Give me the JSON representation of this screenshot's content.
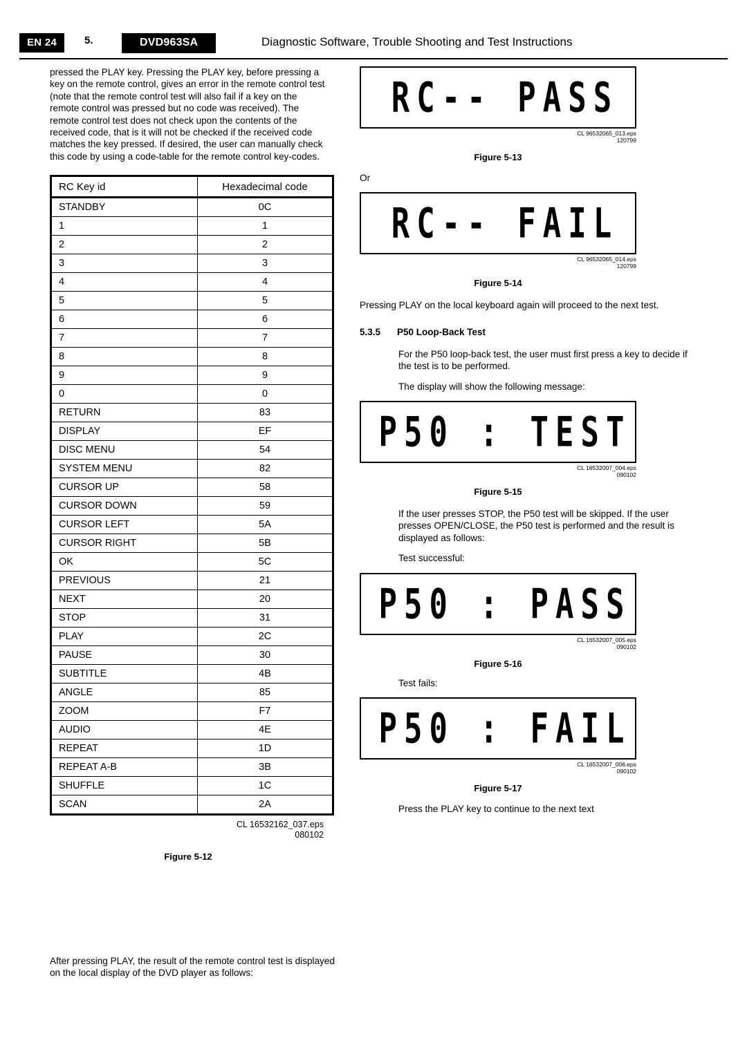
{
  "header": {
    "page_label": "EN 24",
    "section_number": "5.",
    "model": "DVD963SA",
    "title": "Diagnostic Software, Trouble Shooting and Test Instructions"
  },
  "left": {
    "intro_paragraph": "pressed the PLAY key. Pressing the PLAY key, before pressing a key on the remote control, gives an error in the remote control test (note that the remote control test will also fail if a key on the remote control was pressed but no code was received). The remote control test does not check upon the contents of the received code, that is it will not be checked if the received code matches the key pressed. If desired, the user can manually check this code by using a code-table for the remote control key-codes.",
    "table": {
      "headers": [
        "RC Key id",
        "Hexadecimal code"
      ],
      "rows": [
        [
          "STANDBY",
          "0C"
        ],
        [
          "1",
          "1"
        ],
        [
          "2",
          "2"
        ],
        [
          "3",
          "3"
        ],
        [
          "4",
          "4"
        ],
        [
          "5",
          "5"
        ],
        [
          "6",
          "6"
        ],
        [
          "7",
          "7"
        ],
        [
          "8",
          "8"
        ],
        [
          "9",
          "9"
        ],
        [
          "0",
          "0"
        ],
        [
          "RETURN",
          "83"
        ],
        [
          "DISPLAY",
          "EF"
        ],
        [
          "DISC MENU",
          "54"
        ],
        [
          "SYSTEM  MENU",
          "82"
        ],
        [
          "CURSOR UP",
          "58"
        ],
        [
          "CURSOR DOWN",
          "59"
        ],
        [
          "CURSOR LEFT",
          "5A"
        ],
        [
          "CURSOR RIGHT",
          "5B"
        ],
        [
          "OK",
          "5C"
        ],
        [
          "PREVIOUS",
          "21"
        ],
        [
          "NEXT",
          "20"
        ],
        [
          "STOP",
          "31"
        ],
        [
          "PLAY",
          "2C"
        ],
        [
          "PAUSE",
          "30"
        ],
        [
          "SUBTITLE",
          "4B"
        ],
        [
          "ANGLE",
          "85"
        ],
        [
          "ZOOM",
          "F7"
        ],
        [
          "AUDIO",
          "4E"
        ],
        [
          "REPEAT",
          "1D"
        ],
        [
          "REPEAT A-B",
          "3B"
        ],
        [
          "SHUFFLE",
          "1C"
        ],
        [
          "SCAN",
          "2A"
        ]
      ]
    },
    "table_eps_line1": "CL 16532162_037.eps",
    "table_eps_line2": "080102",
    "figure_12_caption": "Figure  5-12",
    "footer_paragraph": "After pressing PLAY, the result of the remote control test is displayed on the local display of the DVD player as follows:"
  },
  "right": {
    "display_13": "RC-- PASS",
    "eps_13_line1": "CL 96532065_013.eps",
    "eps_13_line2": "120799",
    "figure_13_caption": "Figure  5-13",
    "or_text": "Or",
    "display_14": "RC-- FAIL",
    "eps_14_line1": "CL 96532065_014.eps",
    "eps_14_line2": "120799",
    "figure_14_caption": "Figure  5-14",
    "para_after_14": "Pressing PLAY on the local keyboard again will proceed to the next test.",
    "subsection_number": "5.3.5",
    "subsection_title": "P50 Loop-Back Test",
    "para_p50_1": "For the P50 loop-back test, the user must first press a key to decide if the test is to be performed.",
    "para_p50_2": "The display will show the following message:",
    "display_15": "P50 : TEST",
    "eps_15_line1": "CL 16532007_004.eps",
    "eps_15_line2": "090102",
    "figure_15_caption": "Figure  5-15",
    "para_after_15": "If the user presses STOP, the P50 test will be skipped. If the user presses OPEN/CLOSE, the P50 test is performed and the result is displayed as follows:",
    "test_successful_label": "Test successful:",
    "display_16": "P50 : PASS",
    "eps_16_line1": "CL 16532007_005.eps",
    "eps_16_line2": "090102",
    "figure_16_caption": "Figure  5-16",
    "test_fails_label": "Test fails:",
    "display_17": "P50 : FAIL",
    "eps_17_line1": "CL 16532007_006.eps",
    "eps_17_line2": "090102",
    "figure_17_caption": "Figure  5-17",
    "para_after_17": "Press the PLAY key to continue to the next text"
  }
}
